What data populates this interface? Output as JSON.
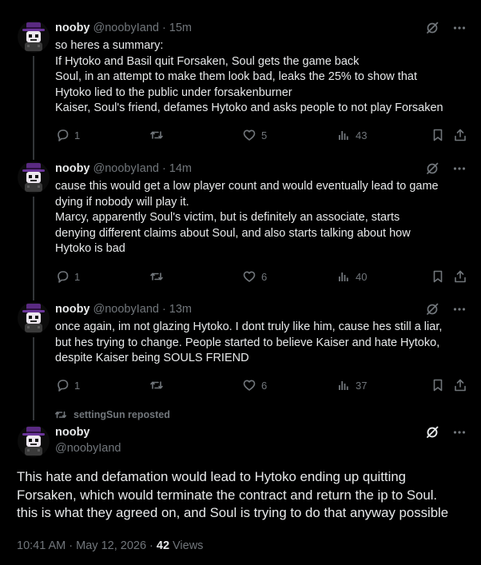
{
  "tweets": [
    {
      "name": "nooby",
      "handle": "@noobyIand",
      "time": "15m",
      "lines": [
        "so heres a summary:",
        "If Hytoko and Basil quit Forsaken, Soul gets the game back",
        "Soul, in an attempt to make them look bad, leaks the 25% to show that",
        "Hytoko lied to the public under forsakenburner",
        "Kaiser, Soul's friend, defames Hytoko and asks people to not play Forsaken"
      ],
      "replies": "1",
      "reposts": "",
      "likes": "5",
      "views": "43"
    },
    {
      "name": "nooby",
      "handle": "@noobyIand",
      "time": "14m",
      "lines": [
        "cause this would get a low player count and would eventually lead to game",
        "dying if nobody will play it.",
        "Marcy, apparently Soul's victim, but is definitely an associate, starts",
        "denying different claims about Soul, and also starts talking about how",
        "Hytoko is bad"
      ],
      "replies": "1",
      "reposts": "",
      "likes": "6",
      "views": "40"
    },
    {
      "name": "nooby",
      "handle": "@noobyIand",
      "time": "13m",
      "lines": [
        "once again, im not glazing Hytoko. I dont truly like him, cause hes still a liar,",
        "but hes trying to change. People started to believe Kaiser and hate Hytoko,",
        "despite Kaiser being SOULS FRIEND"
      ],
      "replies": "1",
      "reposts": "",
      "likes": "6",
      "views": "37"
    }
  ],
  "repost_label": "settingSun reposted",
  "main": {
    "name": "nooby",
    "handle": "@noobyIand",
    "lines": [
      "This hate and defamation would lead to Hytoko ending up quitting",
      "Forsaken, which would terminate the contract and return the ip to Soul.",
      "this is what they agreed on, and Soul is trying to do that anyway possible"
    ],
    "timestamp": "10:41 AM · May 12, 2026 ·",
    "views_count": "42",
    "views_label": "Views"
  },
  "icons": {
    "grok": "grok-slash-icon",
    "more": "more-dots-icon",
    "reply": "reply-bubble-icon",
    "repost": "repost-arrows-icon",
    "like": "heart-icon",
    "views": "views-bars-icon",
    "bookmark": "bookmark-icon",
    "share": "share-icon"
  },
  "colors": {
    "background": "#000000",
    "text": "#e7e9ea",
    "muted": "#71767b",
    "thread_line": "#333639"
  }
}
